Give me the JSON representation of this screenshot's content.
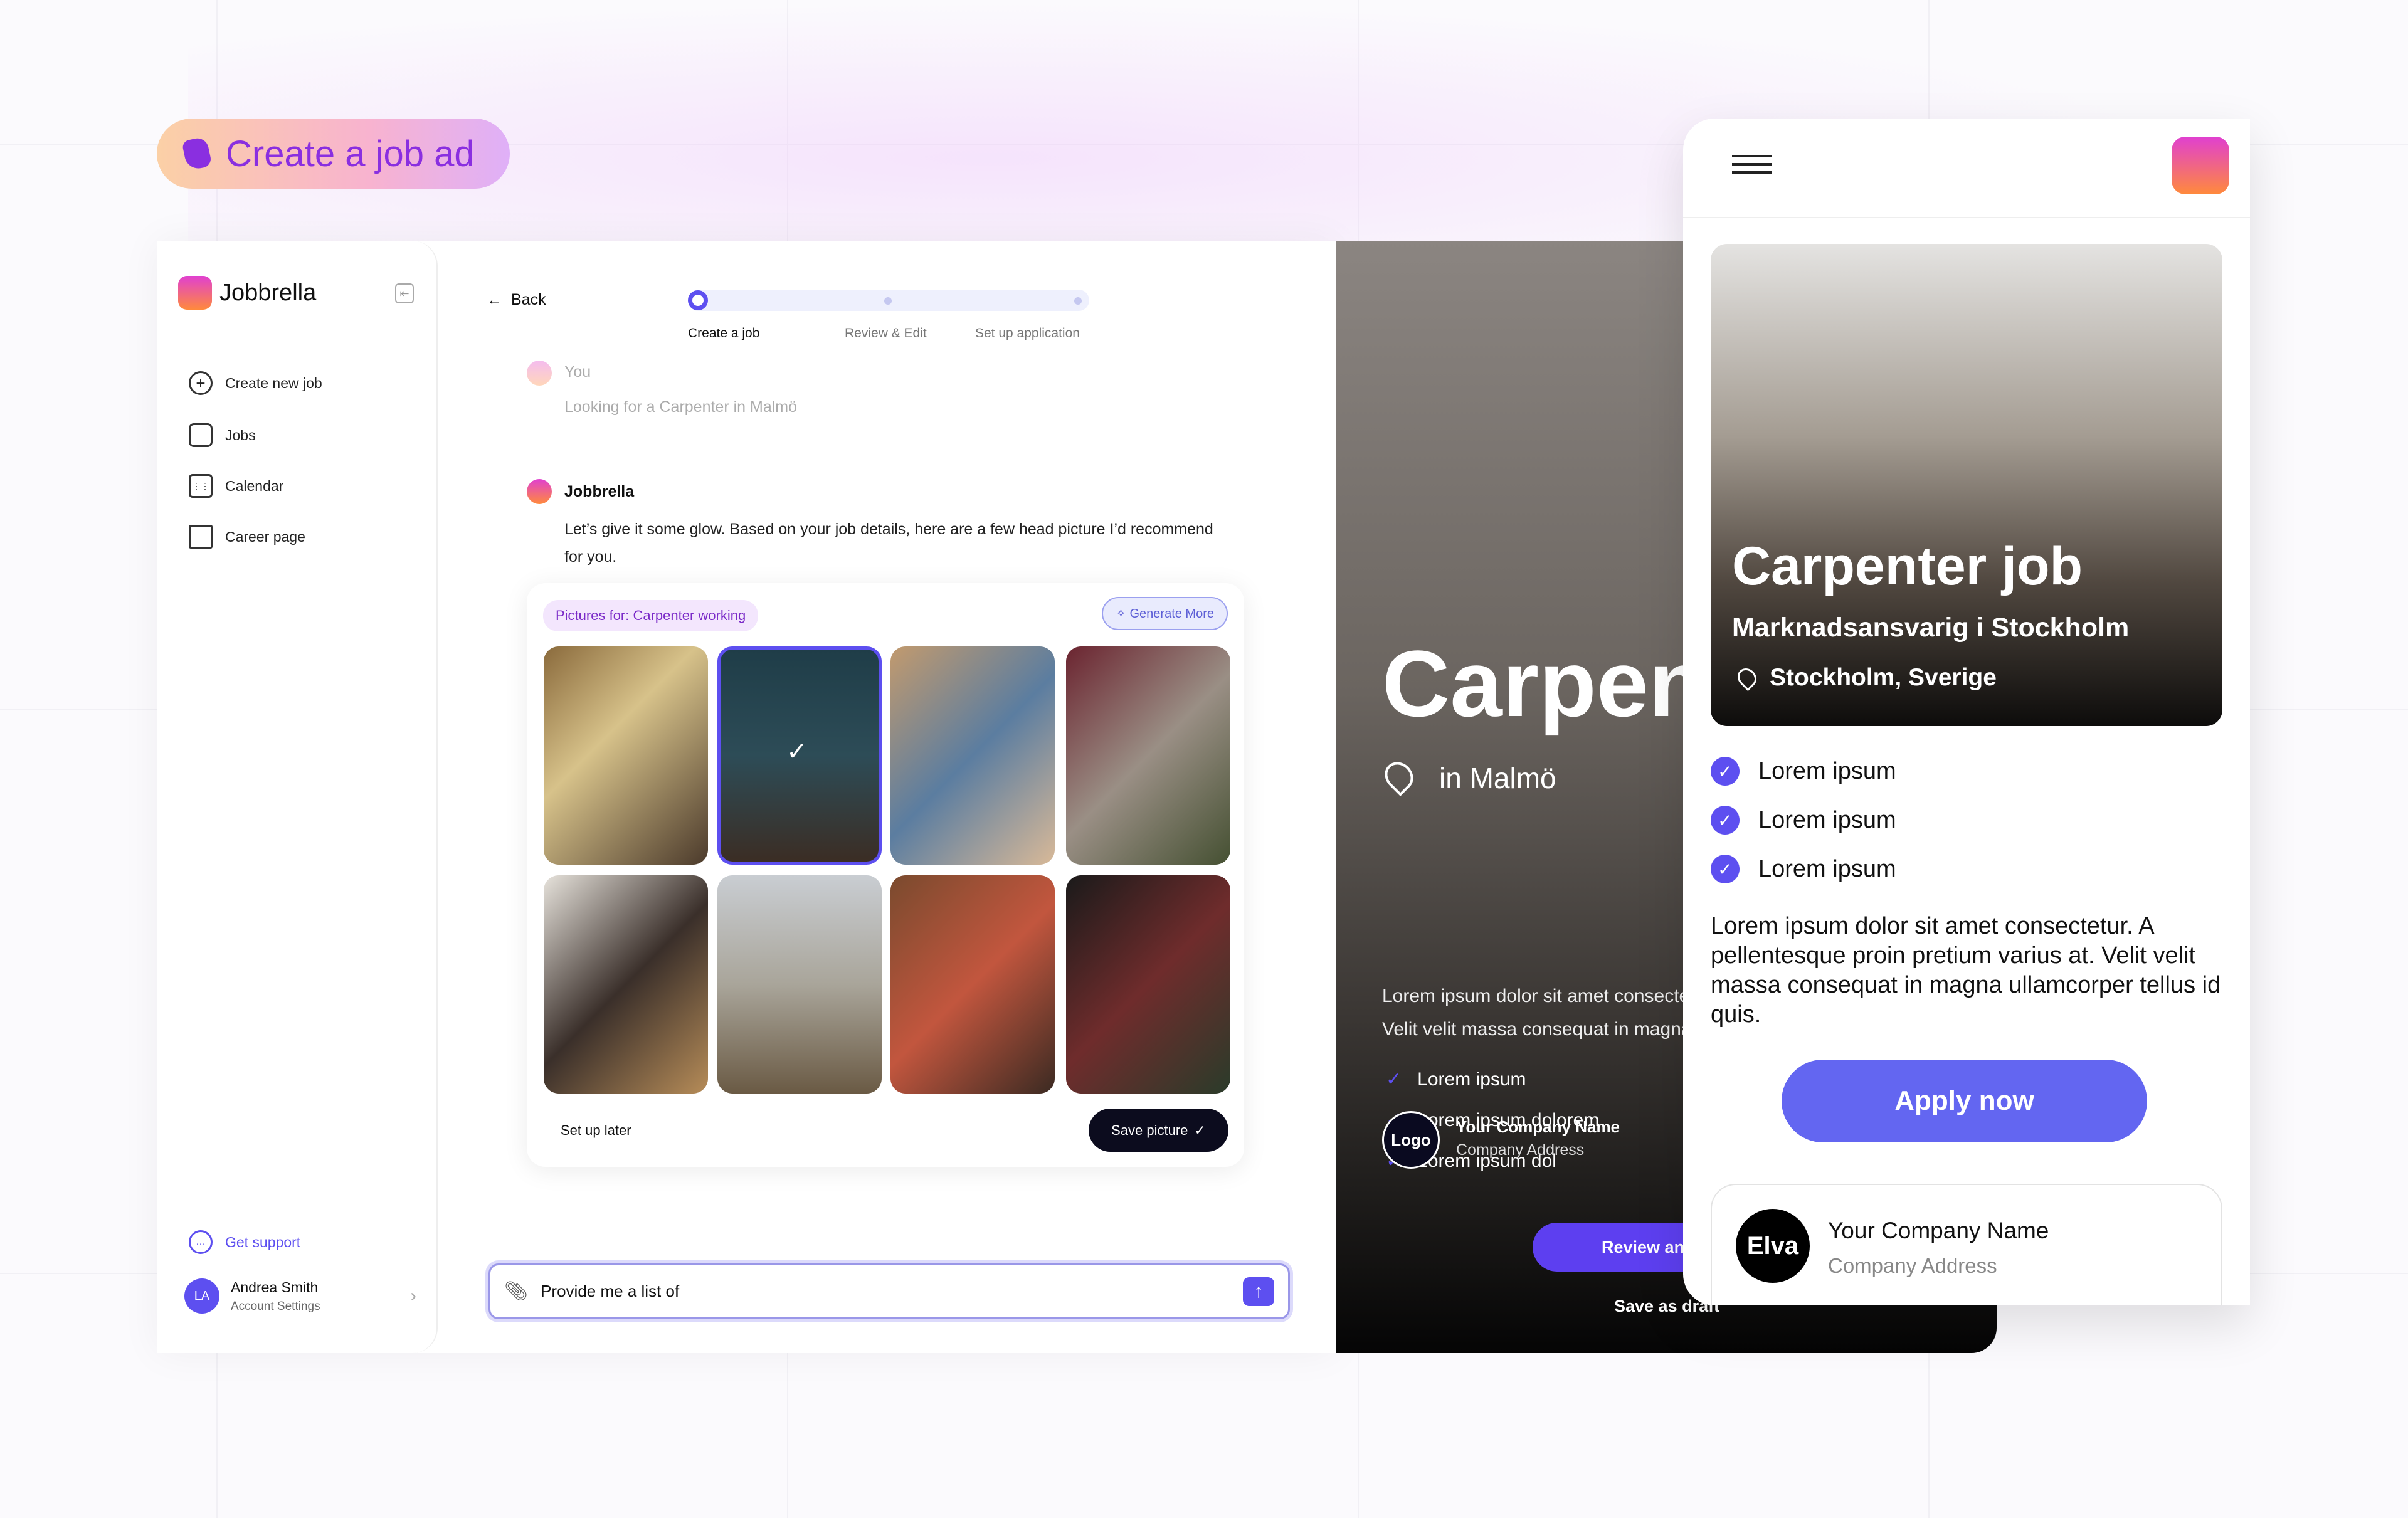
{
  "banner": {
    "title": "Create a job ad"
  },
  "sidebar": {
    "brand": "Jobbrella",
    "items": [
      {
        "label": "Create new job",
        "icon": "plus-circle-icon"
      },
      {
        "label": "Jobs",
        "icon": "bag-icon"
      },
      {
        "label": "Calendar",
        "icon": "calendar-icon"
      },
      {
        "label": "Career page",
        "icon": "building-icon"
      }
    ],
    "support": "Get support",
    "user": {
      "initials": "LA",
      "name": "Andrea Smith",
      "sub": "Account Settings"
    }
  },
  "header": {
    "back": "Back",
    "steps": [
      "Create a job",
      "Review & Edit",
      "Set up application"
    ],
    "active_step": 1
  },
  "chat": {
    "user_name": "You",
    "user_msg": "Looking for a Carpenter in Malmö",
    "bot_name": "Jobbrella",
    "bot_msg": "Let’s give it some glow. Based on your job details, here are a few head picture I’d recommend for you."
  },
  "pictures": {
    "tag": "Pictures for: Carpenter working",
    "generate": "Generate More",
    "selected_index": 1,
    "later": "Set up later",
    "save": "Save picture"
  },
  "input": {
    "value": "Provide me a list of "
  },
  "preview": {
    "title": "Carpenter",
    "location": "in Malmö",
    "bullets": [
      "Lorem ipsum",
      "Lorem ipsum dolorem",
      "Lorem ipsum dol"
    ],
    "paragraph": "Lorem ipsum dolor sit amet consectetur. A pellentesque proin pretium varius at. Velit velit massa consequat in magna ullamcorper tellus id quis.",
    "logo": "Logo",
    "company": "Your Company Name",
    "address": "Company Address",
    "review": "Review and publish",
    "draft": "Save as draft"
  },
  "mobile": {
    "title": "Carpenter job",
    "subtitle": "Marknadsansvarig i Stockholm",
    "location": "Stockholm, Sverige",
    "checks": [
      "Lorem ipsum",
      "Lorem ipsum",
      "Lorem ipsum"
    ],
    "paragraph": "Lorem ipsum dolor sit amet consectetur. A pellentesque proin pretium varius at. Velit velit massa consequat in magna ullamcorper tellus id quis.",
    "apply": "Apply now",
    "logo": "Elva",
    "company": "Your Company Name",
    "address": "Company Address"
  },
  "colors": {
    "accent": "#5d4ff0",
    "banner_text": "#8a2fe0"
  }
}
